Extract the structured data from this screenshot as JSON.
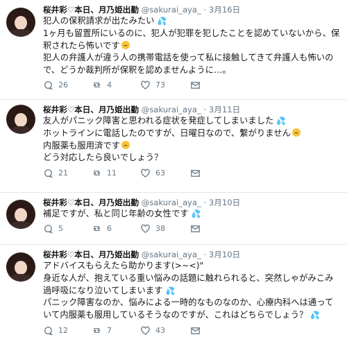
{
  "tweets": [
    {
      "name": "桜井彩♡本日、月乃姫出勤",
      "handle": "@sakurai_aya_",
      "dot": "·",
      "date": "3月16日",
      "lines": [
        "犯人の保釈請求が出たみたい",
        "1ヶ月も留置所にいるのに、犯人が犯罪を犯したことを認めていないから、保釈されたら怖いです",
        "犯人の弁護人が違う人の携帯電話を使って私に接触してきて弁護人も怖いので、どうか裁判所が保釈を認めませんように…。"
      ],
      "replies": "26",
      "retweets": "4",
      "likes": "73"
    },
    {
      "name": "桜井彩♡本日、月乃姫出勤",
      "handle": "@sakurai_aya_",
      "dot": "·",
      "date": "3月11日",
      "lines": [
        "友人がパニック障害と思われる症状を発症してしまいました",
        "ホットラインに電話したのですが、日曜日なので、繋がりません",
        "内服薬も服用済です",
        "どう対応したら良いでしょう？"
      ],
      "replies": "21",
      "retweets": "11",
      "likes": "63"
    },
    {
      "name": "桜井彩♡本日、月乃姫出勤",
      "handle": "@sakurai_aya_",
      "dot": "·",
      "date": "3月10日",
      "lines": [
        "補足ですが、私と同じ年齢の女性です"
      ],
      "replies": "5",
      "retweets": "6",
      "likes": "38"
    },
    {
      "name": "桜井彩♡本日、月乃姫出勤",
      "handle": "@sakurai_aya_",
      "dot": "·",
      "date": "3月10日",
      "lines": [
        "アドバイスもらえたら助かります(>~<)\"",
        "身近な人が、抱えている重い悩みの話題に触れられると、突然しゃがみこみ過呼吸になり泣いてしまいます",
        "パニック障害なのか、悩みによる一時的なものなのか、心療内科へは通っていて内服薬も服用しているそうなのですが、これはどちらでしょう？"
      ],
      "replies": "12",
      "retweets": "7",
      "likes": "43"
    }
  ],
  "icons": [
    "reply-icon",
    "retweet-icon",
    "like-icon",
    "message-icon"
  ]
}
